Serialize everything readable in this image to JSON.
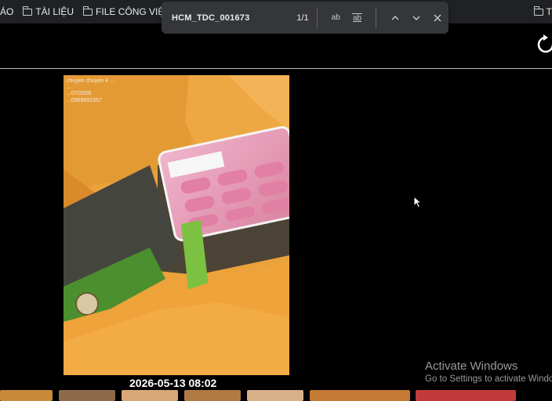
{
  "bookmarks": {
    "items": [
      {
        "label": "ÁO",
        "has_folder_icon": false
      },
      {
        "label": "TÀI LIỆU",
        "has_folder_icon": true
      },
      {
        "label": "FILE CÔNG VIỆC",
        "has_folder_icon": true
      }
    ],
    "right_item": {
      "label": "T"
    }
  },
  "find_bar": {
    "query": "HCM_TDC_001673",
    "match_count": "1/1",
    "match_case_label": "ab",
    "whole_word_label": "ab",
    "icons": [
      "chevron-up-icon",
      "chevron-down-icon",
      "close-icon"
    ]
  },
  "toolbar": {
    "icons": [
      "reload-icon"
    ]
  },
  "photo": {
    "overlay_lines": [
      "chuyen chuyen 4 ...",
      "...",
      "...07/2026",
      "...0969892267"
    ],
    "timestamp": "2026-05-13 08:02"
  },
  "watermark": {
    "title": "Activate Windows",
    "subtitle": "Go to Settings to activate Windows."
  },
  "colors": {
    "bookmarks_bg": "#202124",
    "findbar_bg": "#35363a",
    "page_bg": "#000000",
    "bag_orange": "#e89a2c",
    "tray_pink": "#e890b4"
  }
}
